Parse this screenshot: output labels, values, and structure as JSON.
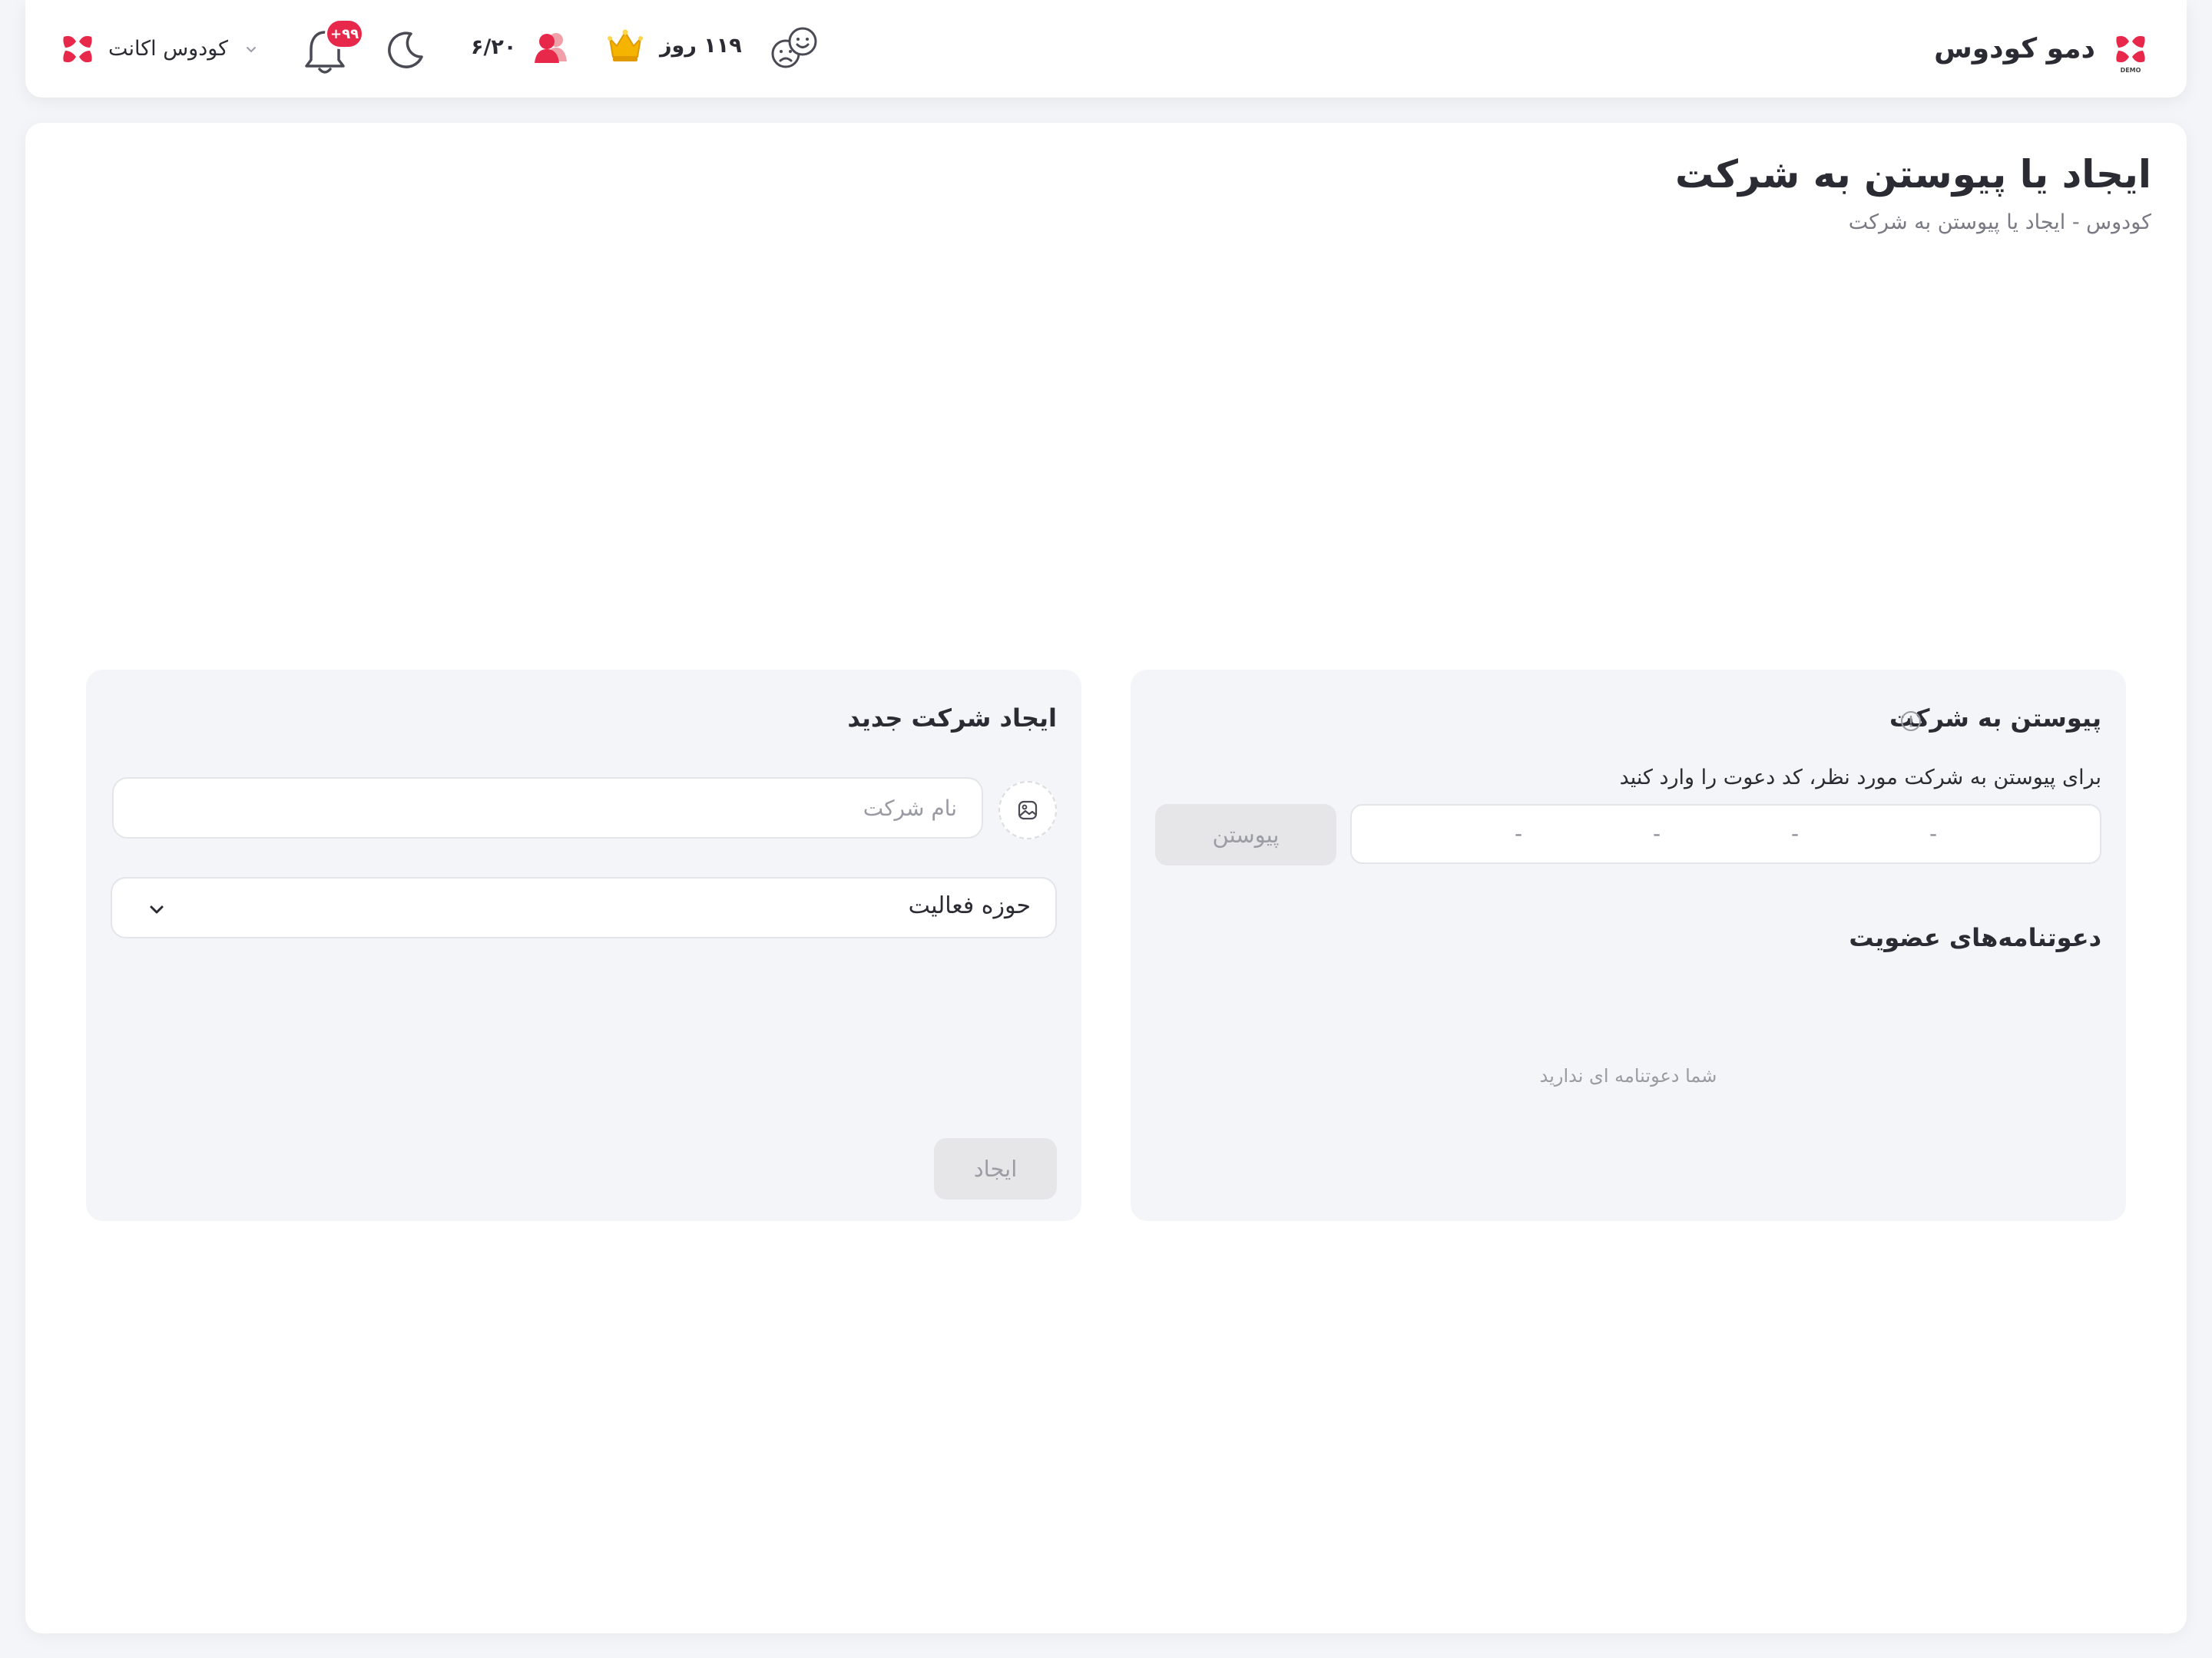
{
  "header": {
    "brand_title": "دمو کودوس",
    "brand_tag": "DEMO",
    "account_name": "کودوس اکانت",
    "notifications_badge": "+۹۹",
    "users_count": "۶/۲۰",
    "subscription_days": "۱۱۹ روز"
  },
  "page": {
    "title": "ایجاد یا پیوستن به شرکت",
    "breadcrumb": "کودوس - ایجاد یا پیوستن به شرکت"
  },
  "join_card": {
    "title": "پیوستن به شرکت",
    "description": "برای پیوستن به شرکت مورد نظر، کد دعوت را وارد کنید",
    "code_placeholders": [
      "-",
      "-",
      "-",
      "-"
    ],
    "join_button": "پیوستن",
    "invites_title": "دعوتنامه‌های عضویت",
    "empty_message": "شما دعوتنامه ای ندارید"
  },
  "create_card": {
    "title": "ایجاد شرکت جدید",
    "name_placeholder": "نام شرکت",
    "activity_label": "حوزه فعالیت",
    "create_button": "ایجاد"
  },
  "colors": {
    "accent_red": "#e8284a",
    "background": "#f4f5f8",
    "card": "#f4f5f8",
    "disabled_button": "#e6e6e9"
  }
}
